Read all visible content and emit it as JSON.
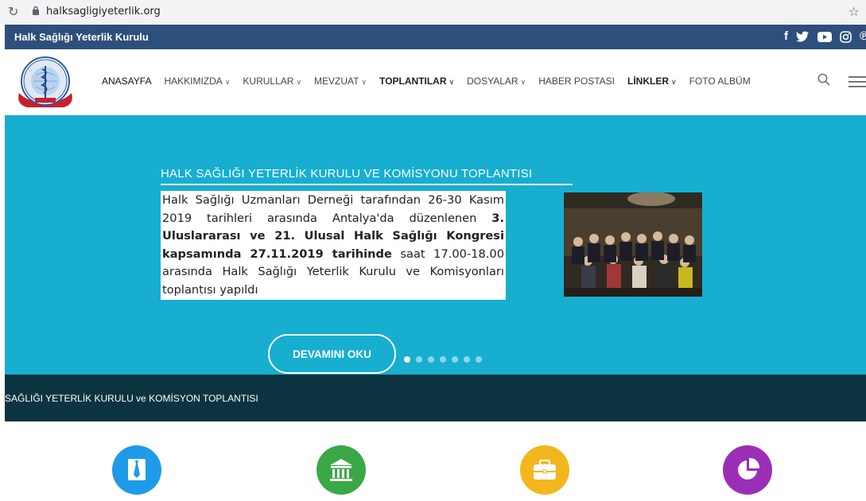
{
  "browser": {
    "url": "halksagligiyeterlik.org"
  },
  "site": {
    "name": "Halk Sağlığı Yeterlik Kurulu"
  },
  "social_icons": [
    "facebook-icon",
    "twitter-icon",
    "youtube-icon",
    "instagram-icon",
    "pinterest-icon"
  ],
  "nav": {
    "items": [
      {
        "label": "ANASAYFA",
        "dropdown": false
      },
      {
        "label": "HAKKIMIZDA",
        "dropdown": true
      },
      {
        "label": "KURULLAR",
        "dropdown": true
      },
      {
        "label": "MEVZUAT",
        "dropdown": true
      },
      {
        "label": "TOPLANTILAR",
        "dropdown": true
      },
      {
        "label": "DOSYALAR",
        "dropdown": true
      },
      {
        "label": "HABER POSTASI",
        "dropdown": false
      },
      {
        "label": "LİNKLER",
        "dropdown": true
      },
      {
        "label": "FOTO ALBÜM",
        "dropdown": false
      }
    ]
  },
  "hero": {
    "title": "HALK SAĞLIĞI YETERLİK KURULU VE KOMİSYONU TOPLANTISI",
    "text_part1": "Halk Sağlığı Uzmanları Derneği tarafından 26-30 Kasım 2019 tarihleri arasında Antalya'da düzenlenen ",
    "text_bold": "3. Uluslararası ve 21. Ulusal Halk Sağlığı Kongresi kapsamında 27.11.2019 tarihinde",
    "text_part2": " saat 17.00-18.00 arasında Halk Sağlığı Yeterlik Kurulu ve Komisyonları toplantısı yapıldı",
    "button": "DEVAMINI OKU",
    "slide_count": 7,
    "active_slide": 1
  },
  "ticker": {
    "text": "SAĞLIĞI YETERLİK KURULU ve KOMİSYON TOPLANTISI"
  },
  "colors": {
    "top_strip": "#2d4f7b",
    "hero_bg": "#17aed0",
    "ticker_bg": "#0b3440",
    "feature_blue": "#1e9be8",
    "feature_green": "#3aa846",
    "feature_yellow": "#f4b61d",
    "feature_purple": "#9a2fb5"
  }
}
